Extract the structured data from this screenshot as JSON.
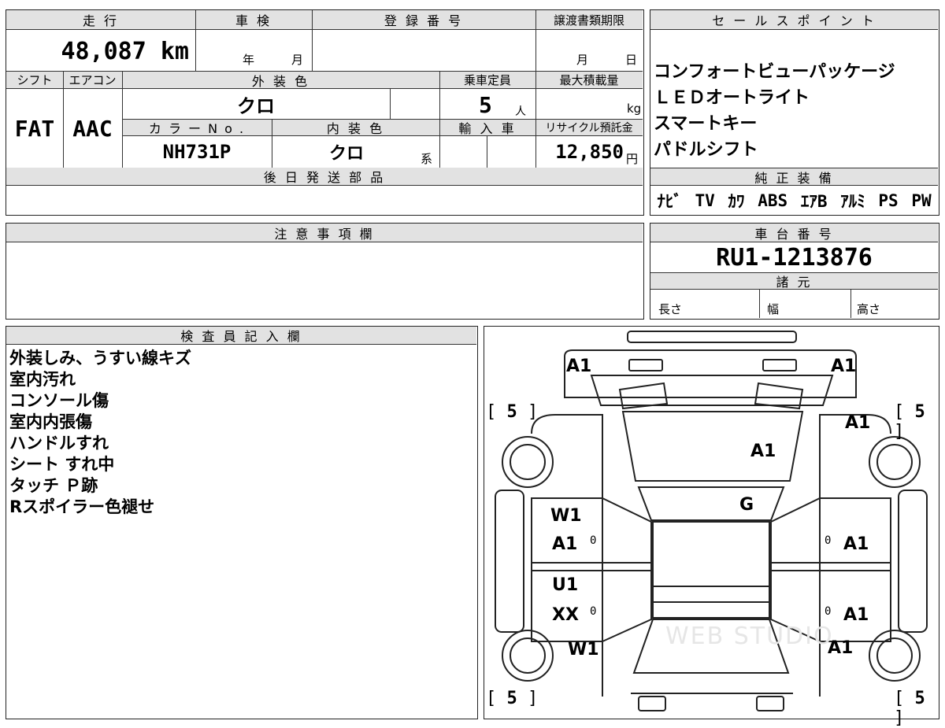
{
  "vehicle": {
    "mileage_label": "走 行",
    "mileage": "48,087 km",
    "inspection_label": "車 検",
    "inspection_year_unit": "年",
    "inspection_month_unit": "月",
    "registration_label": "登 録 番 号",
    "transfer_label": "譲渡書類期限",
    "transfer_month_unit": "月",
    "transfer_day_unit": "日",
    "shift_label": "シフト",
    "shift": "FAT",
    "ac_label": "エアコン",
    "ac": "AAC",
    "exterior_color_label": "外 装 色",
    "exterior_color": "クロ",
    "capacity_label": "乗車定員",
    "capacity": "5",
    "capacity_unit": "人",
    "max_load_label": "最大積載量",
    "max_load_unit": "kg",
    "color_no_label": "カ ラ ー N o .",
    "color_no": "NH731P",
    "interior_color_label": "内 装 色",
    "interior_color": "クロ",
    "interior_color_suffix": "系",
    "import_label": "輸 入 車",
    "recycle_label": "リサイクル預託金",
    "recycle_fee": "12,850",
    "recycle_unit": "円",
    "later_parts_label": "後 日 発 送 部 品"
  },
  "sales_points": {
    "label": "セ ー ル ス ポ イ ン ト",
    "items": [
      "コンフォートビューパッケージ",
      "ＬＥＤオートライト",
      "スマートキー",
      "パドルシフト"
    ]
  },
  "genuine_equipment": {
    "label": "純 正 装 備",
    "items": [
      "ﾅﾋﾞ",
      "TV",
      "ｶﾜ",
      "ABS",
      "ｴｱB",
      "ｱﾙﾐ",
      "PS",
      "PW"
    ]
  },
  "notes": {
    "label": "注 意 事 項 欄"
  },
  "chassis": {
    "label": "車 台 番 号",
    "number": "RU1-1213876",
    "specs_label": "諸 元",
    "length_label": "長さ",
    "width_label": "幅",
    "height_label": "高さ"
  },
  "inspector": {
    "label": "検 査 員 記 入 欄",
    "lines": [
      "外装しみ、うすい線キズ",
      "室内汚れ",
      "コンソール傷",
      "室内内張傷",
      "ハンドルすれ",
      "シート すれ中",
      "タッチ Ｐ跡",
      "Rスポイラー色褪せ"
    ]
  },
  "diagram": {
    "marks": {
      "rear_left": "A1",
      "rear_right": "A1",
      "rear_glass": "A1",
      "glass_g": "G",
      "right_rear_quarter": "A1",
      "right_rear_door": "A1",
      "right_front_door": "A1",
      "right_front_fender": "A1",
      "left_w1_top": "W1",
      "left_a1": "A1",
      "left_u1": "U1",
      "left_xx": "XX",
      "left_w1_bottom": "W1"
    },
    "tire_tl": "5",
    "tire_tr": "5",
    "tire_bl": "5",
    "tire_br": "5",
    "zero": "0",
    "watermark": "WEB STUDIO"
  }
}
